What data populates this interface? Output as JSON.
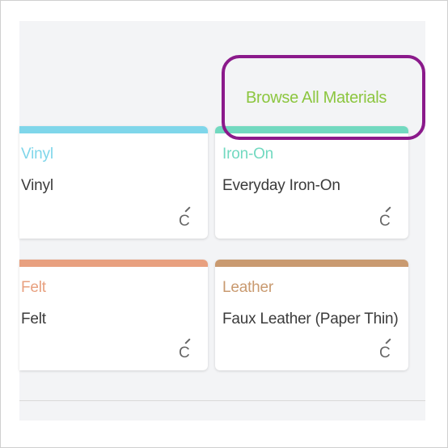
{
  "browse_link": {
    "label": "Browse All Materials",
    "color": "#8cc63f"
  },
  "highlight_color": "#8b1a8b",
  "cards": [
    {
      "category": "Vinyl",
      "material": "Vinyl",
      "accent": "#7fd6ea",
      "icon": "cut-machine-c-icon",
      "icon_glyph": "C"
    },
    {
      "category": "Iron-On",
      "material": "Everyday Iron-On",
      "accent": "#72d9c0",
      "icon": "cut-machine-c-icon",
      "icon_glyph": "C"
    },
    {
      "category": "Felt",
      "material": "Felt",
      "accent": "#e8a07f",
      "icon": "cut-machine-c-icon",
      "icon_glyph": "C"
    },
    {
      "category": "Leather",
      "material": "Faux Leather (Paper Thin)",
      "accent": "#c99a70",
      "icon": "cut-machine-c-icon",
      "icon_glyph": "C"
    }
  ]
}
